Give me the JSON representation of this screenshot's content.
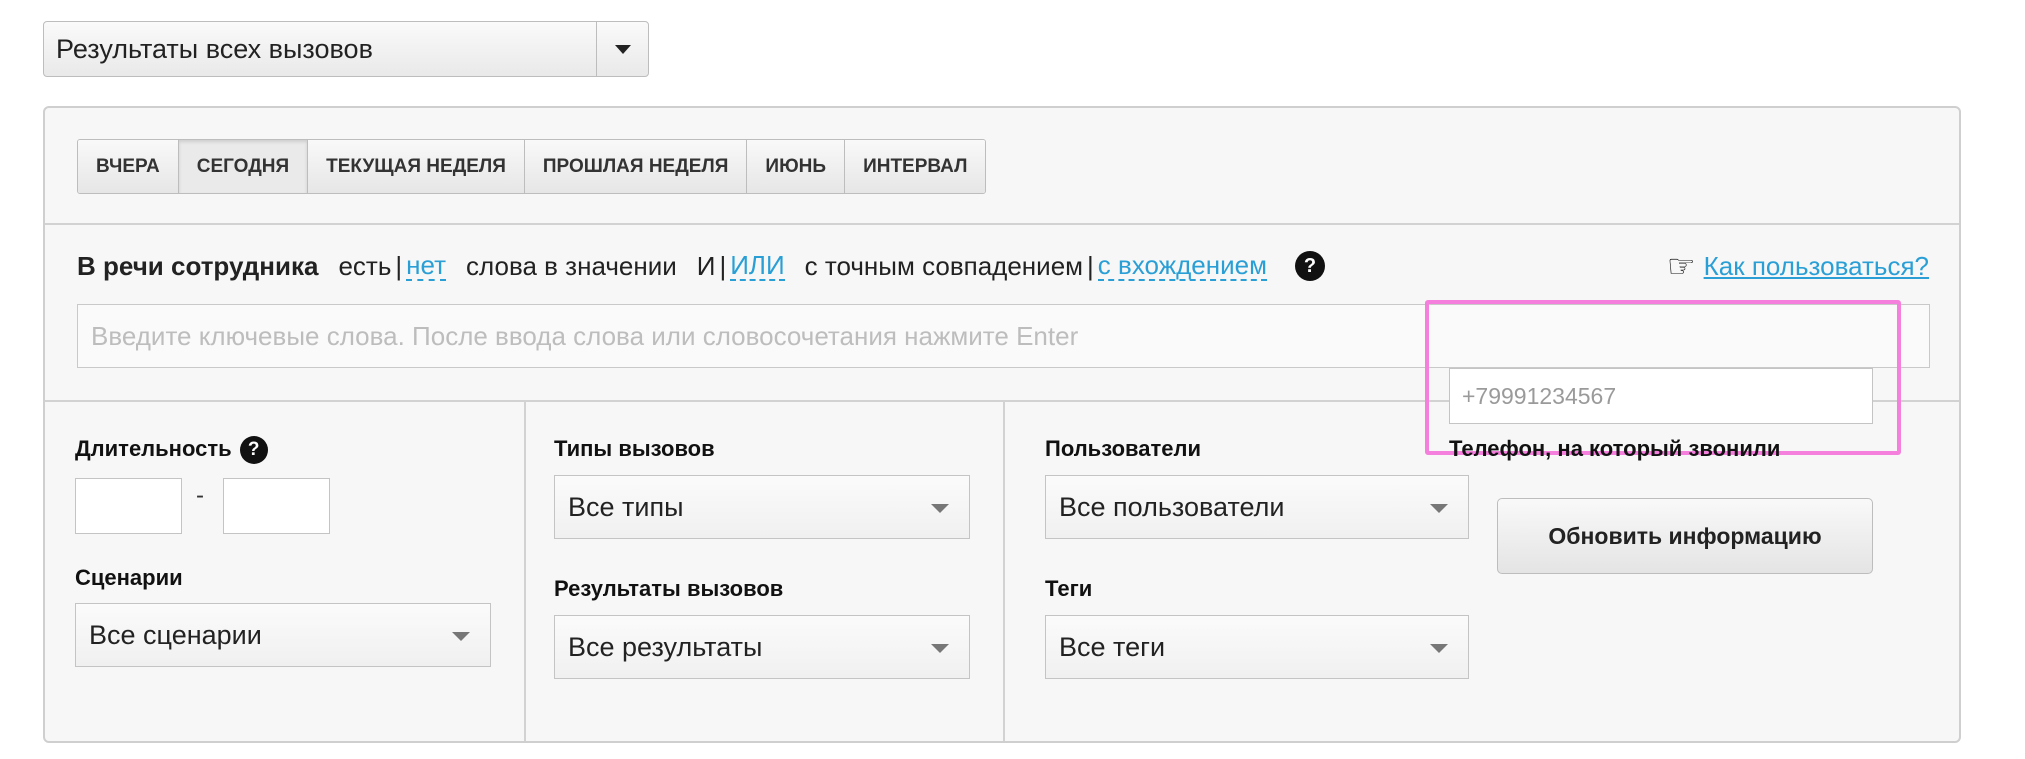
{
  "top_select": {
    "value": "Результаты всех вызовов"
  },
  "period_tabs": [
    {
      "label": "ВЧЕРА"
    },
    {
      "label": "СЕГОДНЯ"
    },
    {
      "label": "ТЕКУЩАЯ НЕДЕЛЯ"
    },
    {
      "label": "ПРОШЛАЯ НЕДЕЛЯ"
    },
    {
      "label": "ИЮНЬ"
    },
    {
      "label": "ИНТЕРВАЛ"
    }
  ],
  "active_period": "СЕГОДНЯ",
  "speech_filter": {
    "title": "В речи сотрудника",
    "has": "есть",
    "sep": "|",
    "not": "нет",
    "words_text": "слова в значении",
    "and": "И",
    "or": "ИЛИ",
    "exact": "с точным совпадением",
    "partial": "с вхождением",
    "help": "?",
    "how_to": "Как пользоваться?",
    "hand_icon": "pointing-hand-icon",
    "keywords_placeholder": "Введите ключевые слова. После ввода слова или словосочетания нажмите Enter"
  },
  "filters": {
    "duration_label": "Длительность",
    "duration_help": "?",
    "duration_dash": "-",
    "scenarios_label": "Сценарии",
    "scenarios_value": "Все сценарии",
    "call_types_label": "Типы вызовов",
    "call_types_value": "Все типы",
    "call_results_label": "Результаты вызовов",
    "call_results_value": "Все результаты",
    "users_label": "Пользователи",
    "users_value": "Все пользователи",
    "tags_label": "Теги",
    "tags_value": "Все теги",
    "phone_label": "Телефон, на который звонили",
    "phone_placeholder": "+79991234567",
    "refresh_button": "Обновить информацию"
  },
  "colors": {
    "link": "#2a9fd6",
    "highlight": "#f57fdc"
  }
}
